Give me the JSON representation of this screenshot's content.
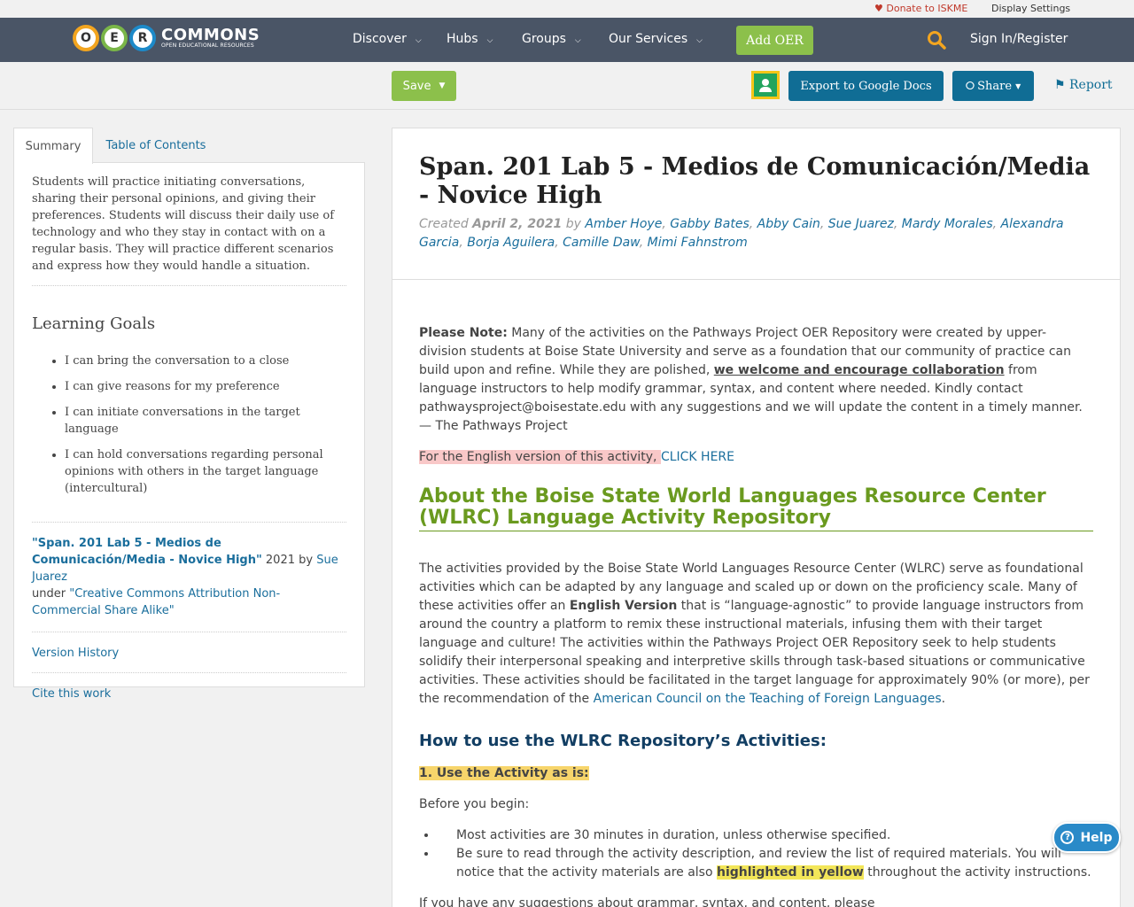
{
  "util": {
    "donate": "Donate to ISKME",
    "display": "Display Settings"
  },
  "nav": {
    "logo_letters": [
      "O",
      "E",
      "R"
    ],
    "logo_brand": "COMMONS",
    "logo_sub": "OPEN EDUCATIONAL RESOURCES",
    "items": [
      "Discover",
      "Hubs",
      "Groups",
      "Our Services"
    ],
    "add_oer": "Add OER",
    "signin": "Sign In/Register"
  },
  "actions": {
    "save": "Save",
    "export": "Export to Google Docs",
    "share": "Share",
    "report": "Report"
  },
  "sidebar": {
    "tabs": [
      "Summary",
      "Table of Contents"
    ],
    "summary": "Students will practice initiating conversations, sharing their personal opinions, and giving their preferences. Students will discuss their daily use of technology and who they stay in contact with on a regular basis. They will practice different scenarios and express how they would handle a situation.",
    "goals_title": "Learning Goals",
    "goals": [
      "I can bring the conversation to a close",
      "I can give reasons for my preference",
      "I can initiate conversations in the target language",
      "I can hold conversations regarding personal opinions with others in the target language (intercultural)"
    ],
    "cite_title": "\"Span. 201 Lab 5 - Medios de Comunicación/Media - Novice High\"",
    "cite_year_by": " 2021 by ",
    "cite_author": "Sue Juarez",
    "cite_under": "under ",
    "cite_license": "\"Creative Commons Attribution Non-Commercial Share Alike\"",
    "version_history": "Version History",
    "cite_work": "Cite this work"
  },
  "main": {
    "title": "Span. 201 Lab 5 - Medios de Comunicación/Media - Novice High",
    "created_label": "Created ",
    "created_date": "April 2, 2021",
    "by": " by ",
    "authors": [
      "Amber Hoye",
      "Gabby Bates",
      "Abby Cain",
      "Sue Juarez",
      "Mardy Morales",
      "Alexandra Garcia",
      "Borja Aguilera",
      "Camille Daw",
      "Mimi Fahnstrom"
    ],
    "note_label": "Please Note:",
    "note_1": " Many of the activities on the Pathways Project OER Repository were created by upper-division students at Boise State University and serve as a foundation that our community of practice can build upon and refine. While they are polished, ",
    "note_link": "we welcome and encourage collaboration",
    "note_2": " from language instructors to help modify grammar, syntax, and content where needed. Kindly contact pathwaysproject@boisestate.edu with any suggestions and we will update the content in a timely manner.  — The Pathways Project",
    "english_text": "For the English version of this activity, ",
    "english_link": "CLICK HERE",
    "about_heading": "About the Boise State World Languages Resource Center (WLRC) Language Activity Repository",
    "about_1": "The activities provided by the Boise State World Languages Resource Center (WLRC) serve as foundational activities which can be adapted by any language and scaled up or down on the proficiency scale. Many of these activities offer an ",
    "about_bold": "English Version",
    "about_2": " that is “language-agnostic” to provide language instructors from around the country a platform to remix these instructional materials, infusing them with their target language and culture! The activities within the Pathways Project OER Repository seek to help students solidify their interpersonal speaking and interpretive skills through task-based situations or communicative activities. These activities should be facilitated in the target language for approximately 90% (or more), per the recommendation of the ",
    "about_link": "American Council on the Teaching of Foreign Languages",
    "about_end": ".",
    "howto_heading": "How to use the WLRC Repository’s Activities:",
    "step1": "1. Use the Activity as is:",
    "before": "Before you begin:",
    "bullet1": "Most activities are 30 minutes in duration, unless otherwise specified.",
    "bullet2a": "Be sure to read through the activity description, and review the list of required materials. You will notice that the activity materials are also ",
    "bullet2_hl": "highlighted in yellow",
    "bullet2b": " throughout the activity instructions.",
    "suggest": "If you have any suggestions about grammar, syntax, and content, please kindly contact pathwaysproject@boisestate.edu."
  },
  "help": "Help"
}
